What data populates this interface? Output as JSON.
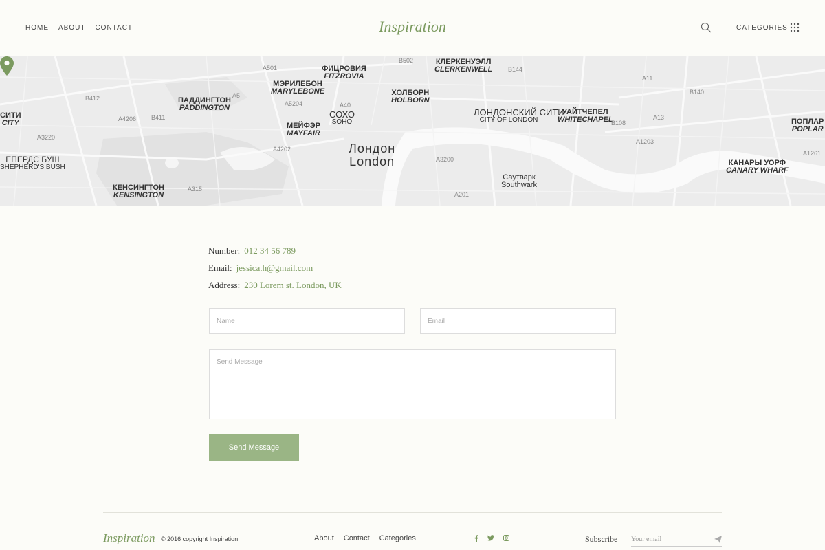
{
  "header": {
    "nav": [
      "HOME",
      "ABOUT",
      "CONTACT"
    ],
    "logo": "Inspiration",
    "categories_label": "CATEGORIES"
  },
  "map": {
    "labels": [
      {
        "ru": "ФИЦРОВИЯ",
        "en": "FITZROVIA"
      },
      {
        "ru": "КЛЕРКЕНУЭЛЛ",
        "en": "CLERKENWELL"
      },
      {
        "ru": "МЭРИЛЕБОН",
        "en": "MARYLEBONE"
      },
      {
        "ru": "ПАДДИНГТОН",
        "en": "PADDINGTON"
      },
      {
        "ru": "ХОЛБОРН",
        "en": "HOLBORN"
      },
      {
        "ru": "СОХО",
        "en": "SOHO"
      },
      {
        "ru": "МЕЙФЭР",
        "en": "MAYFAIR"
      },
      {
        "ru": "ЛОНДОНСКИЙ СИТИ",
        "en": "CITY OF LONDON"
      },
      {
        "ru": "УАЙТЧЕПЕЛ",
        "en": "WHITECHAPEL"
      },
      {
        "ru": "ПОПЛАР",
        "en": "POPLAR"
      },
      {
        "ru": "ЕПЕРДС БУШ",
        "en": "SHEPHERD'S BUSH"
      },
      {
        "ru": "КЕНСИНГТОН",
        "en": "KENSINGTON"
      },
      {
        "ru": "КАНАРЫ УОРФ",
        "en": "CANARY WHARF"
      },
      {
        "ru": "СИТИ",
        "en": "CITY"
      }
    ],
    "city_ru": "Лондон",
    "city_en": "London",
    "southwark_ru": "Саутварк",
    "southwark_en": "Southwark",
    "roads": [
      "A501",
      "A5",
      "A40",
      "A4202",
      "A3220",
      "A315",
      "A3200",
      "A201",
      "A11",
      "A13",
      "A1203",
      "A1261",
      "A4206",
      "B411",
      "B412",
      "A5204",
      "B502",
      "B144",
      "B108",
      "B140"
    ]
  },
  "contact": {
    "number_label": "Number:",
    "number": "012 34 56 789",
    "email_label": "Email:",
    "email": "jessica.h@gmail.com",
    "address_label": "Address:",
    "address": "230 Lorem st. London, UK"
  },
  "form": {
    "name_placeholder": "Name",
    "email_placeholder": "Email",
    "message_placeholder": "Send Message",
    "submit_label": "Send Message"
  },
  "footer": {
    "logo": "Inspiration",
    "copyright": "© 2016 copyright Inspiration",
    "links": [
      "About",
      "Contact",
      "Categories"
    ],
    "social": [
      "f",
      "t",
      "ig"
    ],
    "subscribe_label": "Subscribe",
    "email_placeholder": "Your email"
  },
  "colors": {
    "accent": "#7b9a5f",
    "button": "#9ab585",
    "background": "#fcfcf8",
    "map": "#ececec"
  }
}
